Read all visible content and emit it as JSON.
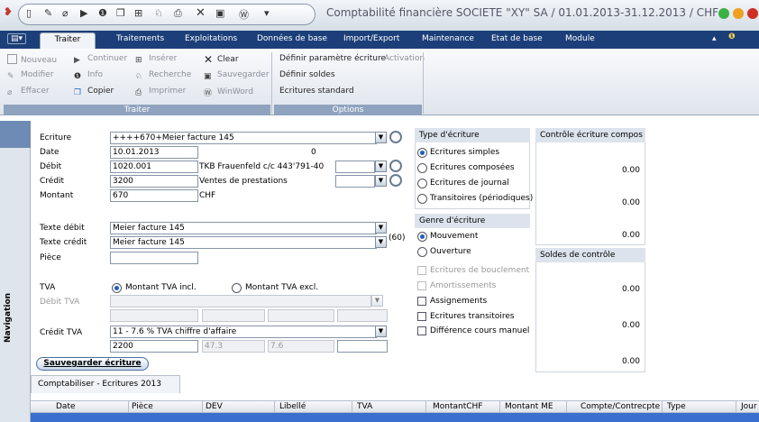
{
  "window": {
    "title": "Comptabilité financière SOCIETE \"XY\" SA / 01.01.2013-31.12.2013 / CHF"
  },
  "tabs": [
    {
      "label": "Traiter"
    },
    {
      "label": "Traitements"
    },
    {
      "label": "Exploitations"
    },
    {
      "label": "Données de base"
    },
    {
      "label": "Import/Export"
    },
    {
      "label": "Maintenance"
    },
    {
      "label": "Etat de base"
    },
    {
      "label": "Module"
    }
  ],
  "ribbon": {
    "group1": {
      "label": "Traiter",
      "nouveau": "Nouveau",
      "continuer": "Continuer",
      "inserer": "Insérer",
      "clear": "Clear",
      "modifier": "Modifier",
      "info": "Info",
      "recherche": "Recherche",
      "sauvegarder": "Sauvegarder",
      "effacer": "Effacer",
      "copier": "Copier",
      "imprimer": "Imprimer",
      "winword": "WinWord"
    },
    "group2": {
      "label": "Options",
      "definir_param": "Définir paramètre écriture",
      "activation": "Activation",
      "definir_soldes": "Définir soldes",
      "ecritures_standard": "Ecritures standard"
    }
  },
  "navigation": {
    "label": "Navigation"
  },
  "form": {
    "ecriture": {
      "label": "Ecriture",
      "value": "++++670+Meier facture 145"
    },
    "date": {
      "label": "Date",
      "value": "10.01.2013",
      "extra": "0"
    },
    "debit": {
      "label": "Débit",
      "value": "1020.001",
      "desc": "TKB Frauenfeld c/c 443'791-40"
    },
    "credit": {
      "label": "Crédit",
      "value": "3200",
      "desc": "Ventes de prestations"
    },
    "montant": {
      "label": "Montant",
      "value": "670",
      "currency": "CHF"
    },
    "texte_debit": {
      "label": "Texte débit",
      "value": "Meier facture 145"
    },
    "texte_credit": {
      "label": "Texte crédit",
      "value": "Meier facture 145",
      "count": "(60)"
    },
    "piece": {
      "label": "Pièce",
      "value": ""
    },
    "tva": {
      "label": "TVA",
      "incl": "Montant TVA incl.",
      "excl": "Montant TVA excl."
    },
    "debit_tva": {
      "label": "Débit TVA"
    },
    "credit_tva": {
      "label": "Crédit TVA",
      "value": "11 - 7.6 % TVA chiffre d'affaire",
      "account": "2200",
      "v1": "47.3",
      "v2": "7.6"
    },
    "save_label": "Sauvegarder écriture"
  },
  "type_ecriture": {
    "header": "Type d'écriture",
    "options": [
      "Ecritures simples",
      "Ecritures composées",
      "Ecritures de journal",
      "Transitoires (périodiques)"
    ]
  },
  "genre_ecriture": {
    "header": "Genre d'écriture",
    "options": [
      "Mouvement",
      "Ouverture"
    ]
  },
  "checks": [
    "Ecritures de bouclement",
    "Amortissements",
    "Assignements",
    "Ecritures transitoires",
    "Différence cours manuel"
  ],
  "controle": {
    "header": "Contrôle écriture compos",
    "values": [
      "0.00",
      "0.00",
      "0.00"
    ]
  },
  "soldes": {
    "header": "Soldes de contrôle",
    "values": [
      "0.00",
      "0.00",
      "0.00"
    ]
  },
  "subtab": "Comptabiliser - Ecritures 2013",
  "table": {
    "columns": [
      "Date",
      "Pièce",
      "DEV",
      "Libellé",
      "TVA",
      "MontantCHF",
      "Montant ME",
      "Compte/Contrecpte",
      "Type",
      "Jour"
    ]
  }
}
